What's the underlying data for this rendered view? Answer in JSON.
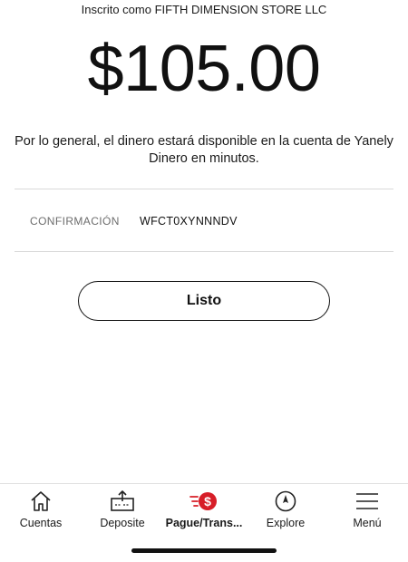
{
  "header": {
    "enrolled_as": "Inscrito como FIFTH DIMENSION STORE LLC"
  },
  "payment": {
    "amount": "$105.00",
    "availability_message": "Por lo general, el dinero estará disponible en la cuenta de Yanely Dinero en minutos."
  },
  "confirmation": {
    "label": "CONFIRMACIÓN",
    "code": "WFCT0XYNNNDV"
  },
  "actions": {
    "done_label": "Listo"
  },
  "tabbar": {
    "items": [
      {
        "label": "Cuentas",
        "icon": "home-icon"
      },
      {
        "label": "Deposite",
        "icon": "deposit-icon"
      },
      {
        "label": "Pague/Trans...",
        "icon": "pay-transfer-icon",
        "active": true
      },
      {
        "label": "Explore",
        "icon": "compass-icon"
      },
      {
        "label": "Menú",
        "icon": "menu-icon"
      }
    ],
    "accent_color": "#d71e28"
  }
}
